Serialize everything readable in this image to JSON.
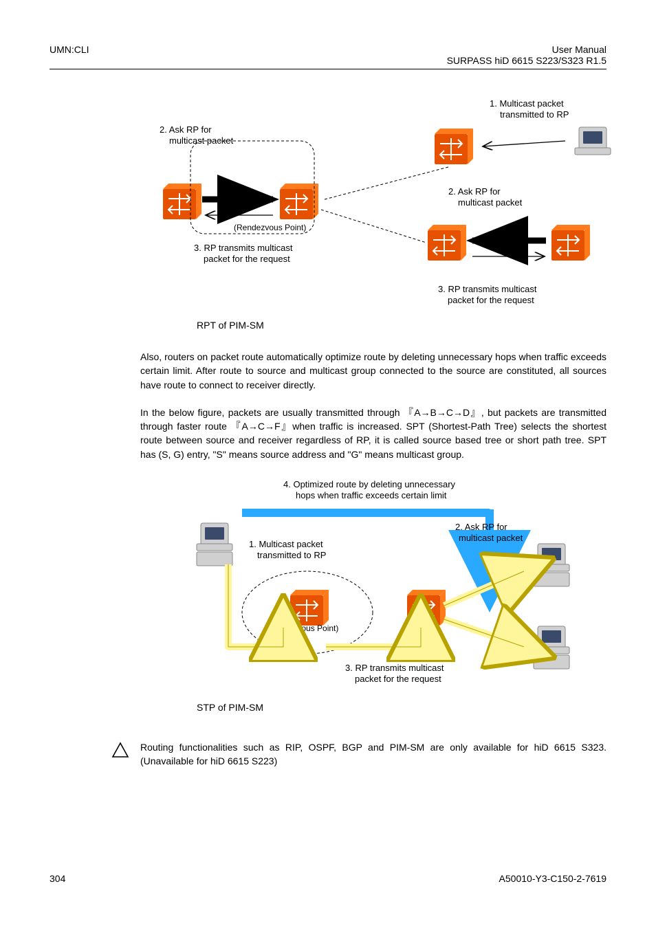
{
  "header": {
    "left": "UMN:CLI",
    "right_line1": "User Manual",
    "right_line2": "SURPASS hiD 6615 S223/S323 R1.5"
  },
  "diagram1": {
    "label_top_right": "1. Multicast packet transmitted to RP",
    "label_top_left": "2. Ask RP for multicast packet",
    "label_mid_right": "2. Ask RP for multicast packet",
    "label_rp": "(Rendezvous Point)",
    "label_bottom_left": "3. RP transmits multicast packet for the request",
    "label_bottom_right": "3. RP transmits multicast packet for the request",
    "caption": "RPT of PIM-SM"
  },
  "paragraph1": "Also, routers on packet route automatically optimize route by deleting unnecessary hops when traffic exceeds certain limit. After route to source and multicast group connected to the source are constituted, all sources have route to connect to receiver directly.",
  "paragraph2": "In the below figure, packets are usually transmitted through 『A→B→C→D』, but packets are transmitted through faster route 『A→C→F』when traffic is increased. SPT (Shortest-Path Tree) selects the shortest route between source and receiver regardless of RP, it is called source based tree or short path tree. SPT has (S, G) entry, \"S\" means source address and \"G\" means multicast group.",
  "diagram2": {
    "label_top": "4. Optimized route by deleting unnecessary hops when traffic exceeds certain limit",
    "label_top_right": "2. Ask RP for multicast packet",
    "label_mid_left": "1. Multicast packet transmitted to RP",
    "label_rp": "(Rendezvous Point)",
    "label_bottom": "3. RP transmits multicast packet for the request",
    "caption": "STP of PIM-SM"
  },
  "note": "Routing functionalities such as RIP, OSPF, BGP and PIM-SM are only available for hiD 6615 S323. (Unavailable for hiD 6615 S223)",
  "footer": {
    "page": "304",
    "docid": "A50010-Y3-C150-2-7619"
  }
}
